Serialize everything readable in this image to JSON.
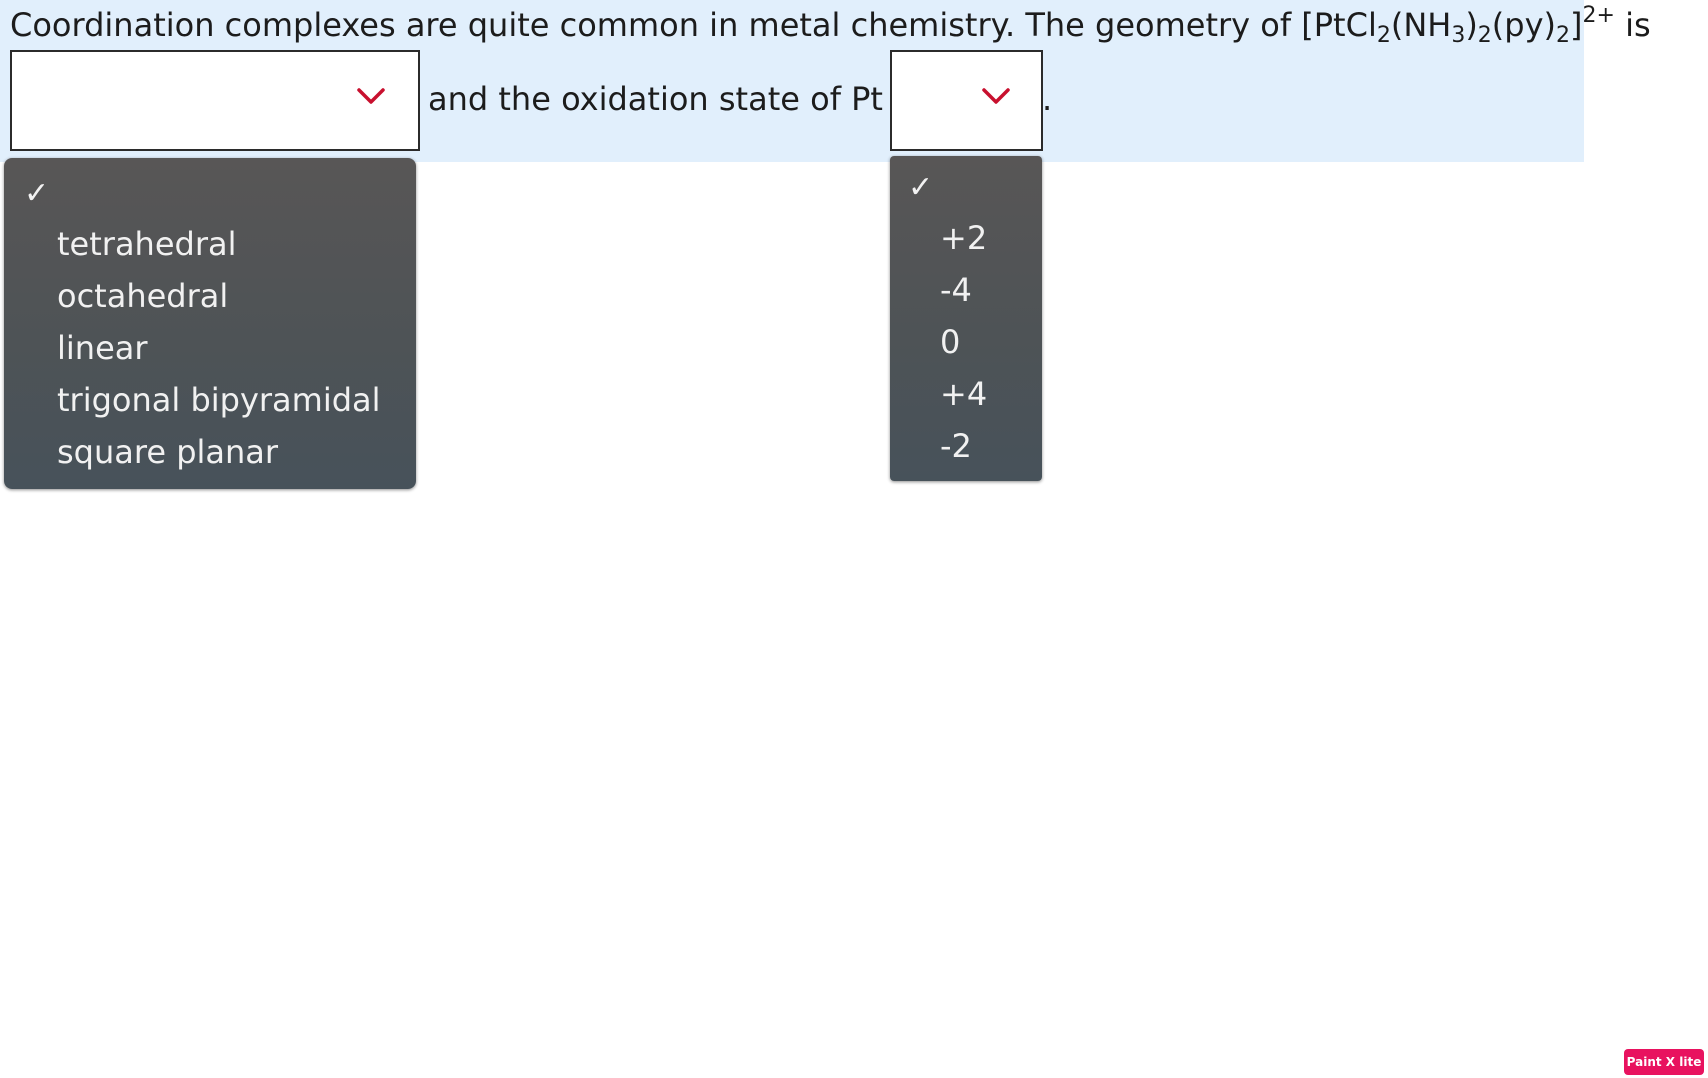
{
  "question": {
    "prefix": "Coordination complexes are quite common in metal chemistry. The geometry of [PtCl",
    "sub1": "2",
    "part2": "(NH",
    "sub2": "3",
    "part3": ")",
    "sub3": "2",
    "part4": "(py)",
    "sub4": "2",
    "part5": "]",
    "charge": "2+",
    "suffix": " is",
    "middle": "and the oxidation state of Pt is",
    "end": "."
  },
  "geometry_select": {
    "selected": "",
    "checkmark": "✓",
    "options": [
      "tetrahedral",
      "octahedral",
      "linear",
      "trigonal bipyramidal",
      "square planar"
    ]
  },
  "oxidation_select": {
    "selected": "",
    "checkmark": "✓",
    "options": [
      "+2",
      "-4",
      "0",
      "+4",
      "-2"
    ]
  },
  "badge": {
    "label": "Paint X lite"
  },
  "colors": {
    "question_band": "#e1effc",
    "chevron": "#c8102e",
    "dropdown_bg": "#4e5356",
    "badge": "#e8125f"
  }
}
